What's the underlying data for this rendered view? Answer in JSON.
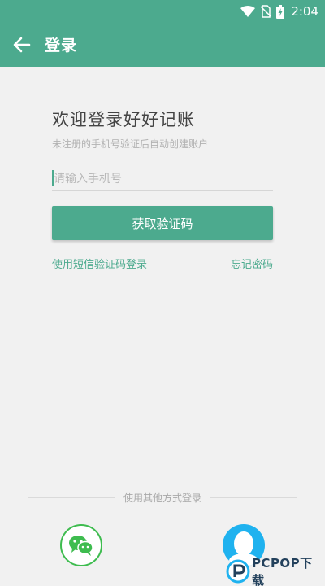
{
  "status_bar": {
    "time": "2:04",
    "icons": [
      "wifi-icon",
      "no-sim-icon",
      "battery-charging-icon"
    ]
  },
  "app_bar": {
    "title": "登录",
    "back_icon": "arrow-left-icon"
  },
  "login": {
    "heading": "欢迎登录好好记账",
    "subtitle": "未注册的手机号验证后自动创建账户",
    "phone_placeholder": "请输入手机号",
    "get_code_label": "获取验证码",
    "sms_login_link": "使用短信验证码登录",
    "forgot_password_link": "忘记密码"
  },
  "other_login": {
    "label": "使用其他方式登录",
    "options": [
      "wechat-icon",
      "qq-icon"
    ]
  },
  "watermark": {
    "text": "PCPOP下载"
  },
  "colors": {
    "primary": "#4caa8e",
    "background": "#f1f1f1",
    "wechat": "#3ebc4f",
    "qq": "#1fb2ef"
  }
}
